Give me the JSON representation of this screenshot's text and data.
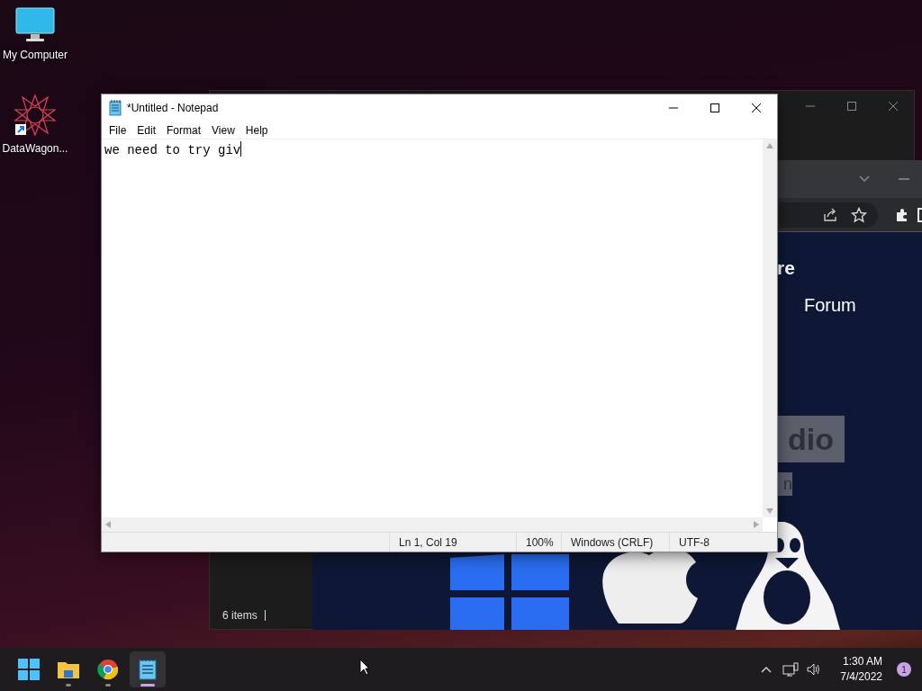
{
  "desktop_icons": [
    {
      "kind": "computer",
      "label": "My Computer"
    },
    {
      "kind": "shortcut",
      "label": "DataWagon..."
    }
  ],
  "explorer_window": {
    "status": "6 items"
  },
  "browser_window": {
    "texts": [
      {
        "kind": "heading",
        "text": "re"
      },
      {
        "kind": "link",
        "text": "Forum"
      },
      {
        "kind": "big-tag",
        "text": "dio"
      },
      {
        "kind": "small-tag",
        "text": "n"
      }
    ]
  },
  "notepad": {
    "title": "*Untitled - Notepad",
    "menu": [
      "File",
      "Edit",
      "Format",
      "View",
      "Help"
    ],
    "text": "we need to try giv",
    "status": {
      "position": "Ln 1, Col 19",
      "zoom": "100%",
      "line_ending": "Windows (CRLF)",
      "encoding": "UTF-8"
    }
  },
  "taskbar": {
    "apps": [
      {
        "kind": "folder",
        "selected": false
      },
      {
        "kind": "browser",
        "selected": false
      },
      {
        "kind": "notepad",
        "selected": true
      }
    ],
    "time": "1:30 AM",
    "date": "7/4/2022",
    "notifications": "1"
  }
}
